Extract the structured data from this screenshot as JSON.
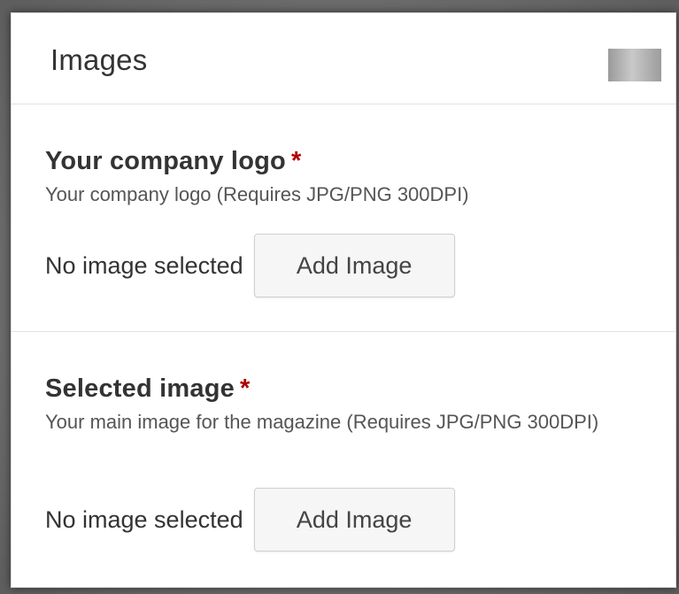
{
  "panel": {
    "title": "Images"
  },
  "fields": [
    {
      "label": "Your company logo",
      "required_mark": "*",
      "help": "Your company logo (Requires JPG/PNG 300DPI)",
      "status": "No image selected",
      "button_label": "Add Image"
    },
    {
      "label": "Selected image",
      "required_mark": "*",
      "help": "Your main image for the magazine (Requires JPG/PNG 300DPI)",
      "status": "No image selected",
      "button_label": "Add Image"
    }
  ],
  "colors": {
    "required": "#b00000",
    "text": "#333333",
    "help_text": "#555555",
    "divider": "#e3e3e3"
  }
}
